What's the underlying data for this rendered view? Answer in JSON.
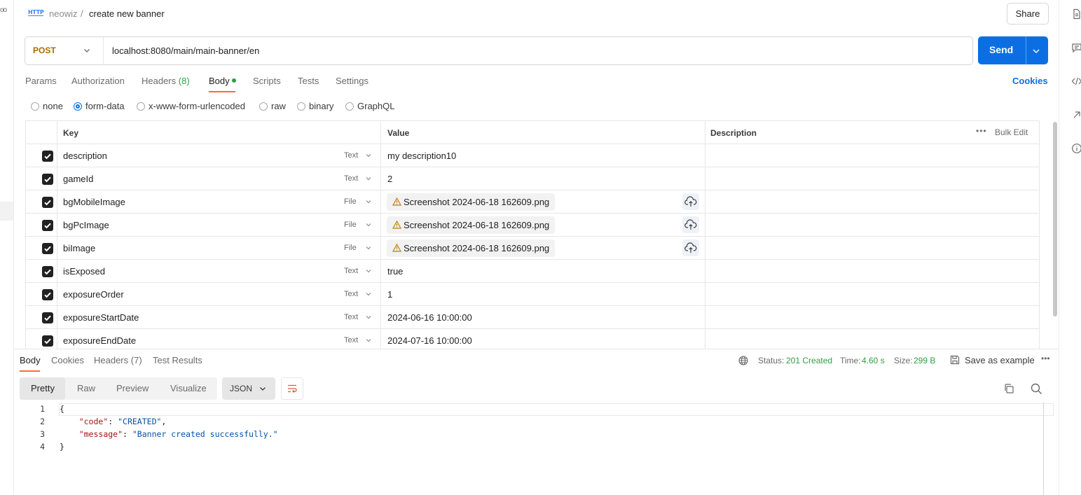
{
  "header": {
    "method_icon": "HTTP",
    "workspace": "neowiz",
    "separator": "/",
    "title": "create new banner",
    "share_label": "Share"
  },
  "request": {
    "method": "POST",
    "url": "localhost:8080/main/main-banner/en",
    "send_label": "Send"
  },
  "request_tabs": {
    "params": "Params",
    "authorization": "Authorization",
    "headers": "Headers",
    "headers_count": "(8)",
    "body": "Body",
    "scripts": "Scripts",
    "tests": "Tests",
    "settings": "Settings",
    "cookies": "Cookies"
  },
  "body_types": {
    "none": "none",
    "form_data": "form-data",
    "urlencoded": "x-www-form-urlencoded",
    "raw": "raw",
    "binary": "binary",
    "graphql": "GraphQL",
    "selected": "form-data"
  },
  "table": {
    "headers": {
      "key": "Key",
      "value": "Value",
      "description": "Description",
      "more": "•••",
      "bulk_edit": "Bulk Edit"
    },
    "rows": [
      {
        "key": "description",
        "type": "Text",
        "value": "my description10"
      },
      {
        "key": "gameId",
        "type": "Text",
        "value": "2"
      },
      {
        "key": "bgMobileImage",
        "type": "File",
        "value": "Screenshot 2024-06-18 162609.png"
      },
      {
        "key": "bgPcImage",
        "type": "File",
        "value": "Screenshot 2024-06-18 162609.png"
      },
      {
        "key": "biImage",
        "type": "File",
        "value": "Screenshot 2024-06-18 162609.png"
      },
      {
        "key": "isExposed",
        "type": "Text",
        "value": "true"
      },
      {
        "key": "exposureOrder",
        "type": "Text",
        "value": "1"
      },
      {
        "key": "exposureStartDate",
        "type": "Text",
        "value": "2024-06-16 10:00:00"
      },
      {
        "key": "exposureEndDate",
        "type": "Text",
        "value": "2024-07-16 10:00:00"
      }
    ]
  },
  "response": {
    "tabs": {
      "body": "Body",
      "cookies": "Cookies",
      "headers": "Headers",
      "headers_count": "(7)",
      "test_results": "Test Results"
    },
    "status_label": "Status:",
    "status_value": "201 Created",
    "time_label": "Time:",
    "time_value": "4.60 s",
    "size_label": "Size:",
    "size_value": "299 B",
    "save_example": "Save as example",
    "more": "•••",
    "view_modes": {
      "pretty": "Pretty",
      "raw": "Raw",
      "preview": "Preview",
      "visualize": "Visualize"
    },
    "format": "JSON",
    "code": {
      "line_numbers": [
        "1",
        "2",
        "3",
        "4"
      ],
      "open": "{",
      "code_key": "\"code\"",
      "code_value": "\"CREATED\"",
      "message_key": "\"message\"",
      "message_value": "\"Banner created successfully.\"",
      "close": "}"
    }
  },
  "colors": {
    "accent": "#0b6fe3",
    "tab_underline": "#ff6c37",
    "method": "#a86b00",
    "status_ok": "#2f9e44"
  },
  "icons": [
    "http-icon",
    "chevron-down-icon",
    "warning-icon",
    "cloud-upload-icon",
    "checkbox-icon",
    "globe-icon",
    "save-icon",
    "copy-icon",
    "search-icon",
    "wrap-icon",
    "document-icon",
    "comment-icon",
    "code-icon",
    "arrow-icon",
    "info-icon"
  ]
}
